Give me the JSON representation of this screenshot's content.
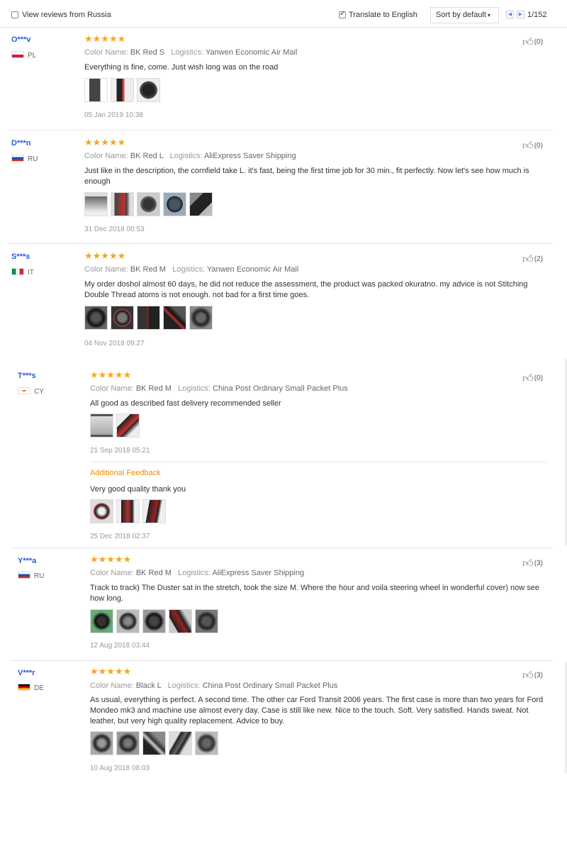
{
  "header": {
    "view_reviews_label": "View reviews from Russia",
    "translate_label": "Translate to English",
    "sort_label": "Sort by default",
    "page_text": "1/152"
  },
  "reviews": [
    {
      "user": "O***v",
      "country": "PL",
      "stars": "★★★★★",
      "color_label": "Color Name:",
      "color": "BK Red S",
      "logistics_label": "Logistics:",
      "logistics": "Yanwen Economic Air Mail",
      "text": "Everything is fine, come. Just wish long was on the road",
      "date": "05 Jan 2019 10:38",
      "likes": "(0)",
      "photo_count": 3
    },
    {
      "user": "D***n",
      "country": "RU",
      "stars": "★★★★★",
      "color_label": "Color Name:",
      "color": "BK Red L",
      "logistics_label": "Logistics:",
      "logistics": "AliExpress Saver Shipping",
      "text": "Just like in the description, the cornfield take L. it's fast, being the first time job for 30 min., fit perfectly. Now let's see how much is enough",
      "date": "31 Dec 2018 00:53",
      "likes": "(0)",
      "photo_count": 5
    },
    {
      "user": "S***s",
      "country": "IT",
      "stars": "★★★★★",
      "color_label": "Color Name:",
      "color": "BK Red M",
      "logistics_label": "Logistics:",
      "logistics": "Yanwen Economic Air Mail",
      "text": "My order doshol almost 60 days, he did not reduce the assessment, the product was packed okuratno. my advice is not Stitching Double Thread atoms is not enough. not bad for a first time goes.",
      "date": "04 Nov 2018 09:27",
      "likes": "(2)",
      "photo_count": 5
    },
    {
      "user": "T***s",
      "country": "CY",
      "stars": "★★★★★",
      "color_label": "Color Name:",
      "color": "BK Red M",
      "logistics_label": "Logistics:",
      "logistics": "China Post Ordinary Small Packet Plus",
      "text": "All good as described fast delivery recommended seller",
      "date": "21 Sep 2018 05:21",
      "likes": "(0)",
      "photo_count": 2,
      "additional_label": "Additional Feedback",
      "additional_text": "Very good quality thank you",
      "additional_date": "25 Dec 2018 02:37",
      "additional_photo_count": 3
    },
    {
      "user": "Y***a",
      "country": "RU",
      "stars": "★★★★★",
      "color_label": "Color Name:",
      "color": "BK Red M",
      "logistics_label": "Logistics:",
      "logistics": "AliExpress Saver Shipping",
      "text": "Track to track) The Duster sat in the stretch, took the size M. Where the hour and voila steering wheel in wonderful cover) now see how long.",
      "date": "12 Aug 2018 03:44",
      "likes": "(3)",
      "photo_count": 5
    },
    {
      "user": "V***r",
      "country": "DE",
      "stars": "★★★★★",
      "color_label": "Color Name:",
      "color": "Black L",
      "logistics_label": "Logistics:",
      "logistics": "China Post Ordinary Small Packet Plus",
      "text": "As usual, everything is perfect. A second time. The other car Ford Transit 2006 years. The first case is more than two years for Ford Mondeo mk3 and machine use almost every day. Case is still like new. Nice to the touch. Soft. Very satisfied. Hands sweat. Not leather, but very high quality replacement. Advice to buy.",
      "date": "10 Aug 2018 08:03",
      "likes": "(3)",
      "photo_count": 5
    }
  ],
  "colors": {
    "star": "#f5a623",
    "username": "#2a5bd7",
    "additional_feedback": "#f08c00"
  }
}
